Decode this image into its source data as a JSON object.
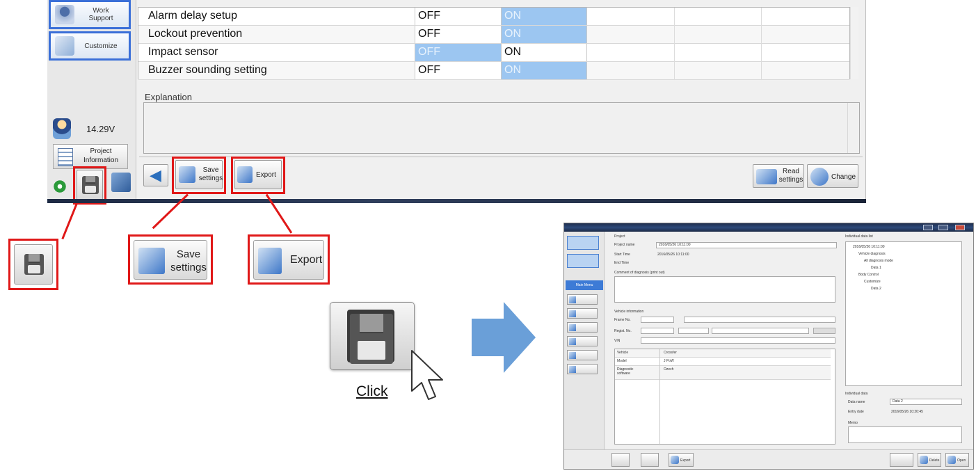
{
  "top_window": {
    "sidebar": {
      "work_support_label": "Work Support",
      "customize_label": "Customize",
      "voltage": "14.29V",
      "project_information_label": "Project Information"
    },
    "settings_rows": [
      {
        "name": "Alarm delay setup",
        "off": "OFF",
        "on": "ON",
        "selected": "on"
      },
      {
        "name": "Lockout prevention",
        "off": "OFF",
        "on": "ON",
        "selected": "on"
      },
      {
        "name": "Impact sensor",
        "off": "OFF",
        "on": "ON",
        "selected": "off"
      },
      {
        "name": "Buzzer sounding setting",
        "off": "OFF",
        "on": "ON",
        "selected": "on"
      }
    ],
    "explanation_label": "Explanation",
    "toolbar": {
      "save_settings_label": "Save settings",
      "export_label": "Export",
      "read_settings_label": "Read settings",
      "change_label": "Change"
    }
  },
  "zoom": {
    "save_settings_label": "Save settings",
    "export_label": "Export"
  },
  "click_label": "Click",
  "second_screenshot": {
    "project_label": "Project",
    "project_name_label": "Project name",
    "project_name_value": "2016/05/26 10:11:00",
    "start_time_label": "Start Time",
    "start_time_value": "2016/05/26 10:11:00",
    "end_time_label": "End Time",
    "comment_label": "Comment of diagnosis (print out)",
    "vehicle_info_label": "Vehicle information",
    "frame_no_label": "Frame No.",
    "regist_no_label": "Regist. No.",
    "vin_label": "VIN",
    "grid_rows": [
      {
        "key": "Vehicle",
        "value": "Crossfer"
      },
      {
        "key": "Model",
        "value": "J PoW"
      },
      {
        "key": "Diagnostic software",
        "value": "Ozech"
      }
    ],
    "individual_data_list_label": "Individual data list",
    "tree": [
      "2016/05/26 10:11:00",
      "Vehicle diagnosis",
      "All diagnosis mode",
      "Data 1",
      "Body Control",
      "Customize",
      "Data 2"
    ],
    "individual_data_label": "Individual data",
    "data_name_label": "Data name",
    "data_name_value": "Data 2",
    "entry_date_label": "Entry date",
    "entry_date_value": "2016/05/26 10:20:45",
    "memo_label": "Memo",
    "main_menu_label": "Main Menu",
    "export_label": "Export",
    "delete_label": "Delete",
    "open_label": "Open"
  },
  "colors": {
    "highlight_red": "#e01818",
    "selected_cell_blue": "#9cc6f1",
    "nav_border_blue": "#3a6fd8",
    "arrow_blue": "#6a9fd8"
  }
}
